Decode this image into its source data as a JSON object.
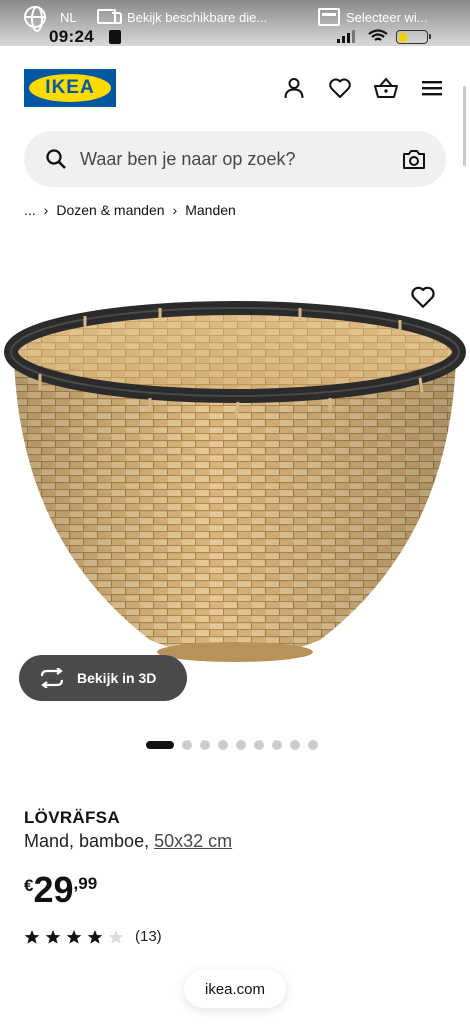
{
  "status_bar": {
    "language": "NL",
    "notification_1": "Bekijk beschikbare die...",
    "notification_2": "Selecteer wi...",
    "time": "09:24",
    "battery_level": 0.3,
    "battery_color": "#f4d000"
  },
  "header": {
    "logo_text": "IKEA",
    "brand_blue": "#0058a3",
    "brand_yellow": "#ffdb00",
    "icons": [
      "user-icon",
      "heart-icon",
      "basket-icon",
      "menu-icon"
    ]
  },
  "search": {
    "placeholder": "Waar ben je naar op zoek?"
  },
  "breadcrumb": {
    "ellipsis": "...",
    "separator": "›",
    "items": [
      "Dozen & manden",
      "Manden"
    ]
  },
  "gallery": {
    "view_3d_label": "Bekijk in 3D",
    "image_count": 9,
    "active_index": 0
  },
  "product": {
    "name": "LÖVRÄFSA",
    "description": "Mand, bamboe,",
    "size": "50x32 cm",
    "price": {
      "currency": "€",
      "integer": "29",
      "decimal": ",99"
    },
    "rating": {
      "value": 4,
      "max": 5,
      "count": "(13)"
    }
  },
  "browser": {
    "url": "ikea.com"
  }
}
